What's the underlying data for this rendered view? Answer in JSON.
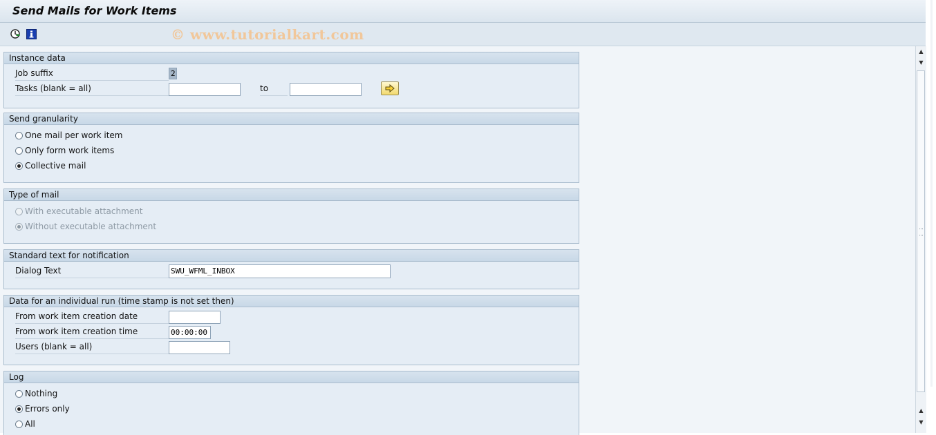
{
  "window": {
    "title": "Send Mails for Work Items"
  },
  "watermark": "© www.tutorialkart.com",
  "toolbar": {
    "execute_icon": "execute-clock-icon",
    "info_icon": "info-icon"
  },
  "groups": {
    "instance": {
      "title": "Instance data",
      "job_suffix_label": "Job suffix",
      "job_suffix_value": "2",
      "tasks_label": "Tasks (blank = all)",
      "tasks_from": "",
      "to_label": "to",
      "tasks_to": ""
    },
    "granularity": {
      "title": "Send granularity",
      "options": [
        {
          "label": "One mail per work item",
          "selected": false
        },
        {
          "label": "Only form work items",
          "selected": false
        },
        {
          "label": "Collective mail",
          "selected": true
        }
      ]
    },
    "mail_type": {
      "title": "Type of mail",
      "options": [
        {
          "label": "With executable attachment",
          "selected": false
        },
        {
          "label": "Without executable attachment",
          "selected": true
        }
      ]
    },
    "standard_text": {
      "title": "Standard text for notification",
      "dialog_text_label": "Dialog Text",
      "dialog_text_value": "SWU_WFML_INBOX"
    },
    "individual_run": {
      "title": "Data for an individual run (time stamp is not set then)",
      "from_date_label": "From work item creation date",
      "from_date_value": "",
      "from_time_label": "From work item creation time",
      "from_time_value": "00:00:00",
      "users_label": "Users (blank = all)",
      "users_value": ""
    },
    "log": {
      "title": "Log",
      "options": [
        {
          "label": "Nothing",
          "selected": false
        },
        {
          "label": "Errors only",
          "selected": true
        },
        {
          "label": "All",
          "selected": false
        }
      ]
    }
  },
  "colors": {
    "accent": "#e5edf5",
    "header": "#c8d8e7",
    "watermark": "#f1c79a"
  }
}
